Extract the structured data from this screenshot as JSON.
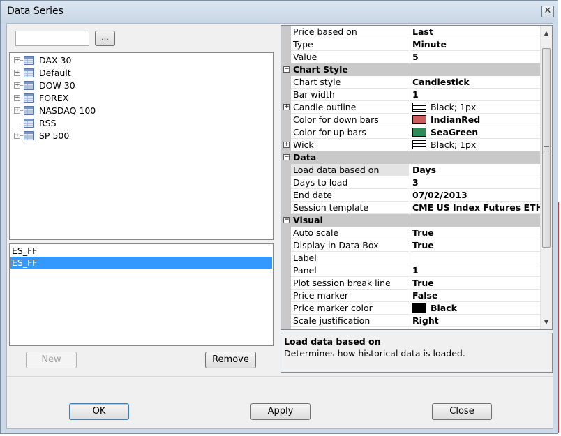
{
  "window": {
    "title": "Data Series",
    "close_glyph": "✕"
  },
  "search": {
    "value": "",
    "browse_label": "..."
  },
  "tree": {
    "items": [
      {
        "label": "DAX 30",
        "expandable": true
      },
      {
        "label": "Default",
        "expandable": true
      },
      {
        "label": "DOW 30",
        "expandable": true
      },
      {
        "label": "FOREX",
        "expandable": true
      },
      {
        "label": "NASDAQ 100",
        "expandable": true
      },
      {
        "label": "RSS",
        "expandable": false
      },
      {
        "label": "SP 500",
        "expandable": true
      }
    ]
  },
  "series_list": {
    "items": [
      {
        "label": "ES_FF",
        "selected": false
      },
      {
        "label": "ES_FF",
        "selected": true
      }
    ],
    "new_label": "New",
    "remove_label": "Remove"
  },
  "properties": {
    "top_rows": [
      {
        "name": "Price based on",
        "value": "Last"
      },
      {
        "name": "Type",
        "value": "Minute"
      },
      {
        "name": "Value",
        "value": "5"
      }
    ],
    "chart_style": {
      "category": "Chart Style",
      "rows": [
        {
          "name": "Chart style",
          "value": "Candlestick"
        },
        {
          "name": "Bar width",
          "value": "1"
        },
        {
          "name": "Candle outline",
          "value": "Black; 1px",
          "expandable": true
        },
        {
          "name": "Color for down bars",
          "value": "IndianRed",
          "swatch": "#cd5c5c"
        },
        {
          "name": "Color for up bars",
          "value": "SeaGreen",
          "swatch": "#2e8b57"
        },
        {
          "name": "Wick",
          "value": "Black; 1px",
          "expandable": true
        }
      ]
    },
    "data": {
      "category": "Data",
      "rows": [
        {
          "name": "Load data based on",
          "value": "Days",
          "highlighted": true
        },
        {
          "name": "Days to load",
          "value": "3"
        },
        {
          "name": "End date",
          "value": "07/02/2013"
        },
        {
          "name": "Session template",
          "value": "CME US Index Futures ETH"
        }
      ]
    },
    "visual": {
      "category": "Visual",
      "rows": [
        {
          "name": "Auto scale",
          "value": "True"
        },
        {
          "name": "Display in Data Box",
          "value": "True"
        },
        {
          "name": "Label",
          "value": ""
        },
        {
          "name": "Panel",
          "value": "1"
        },
        {
          "name": "Plot session break line",
          "value": "True"
        },
        {
          "name": "Price marker",
          "value": "False"
        },
        {
          "name": "Price marker color",
          "value": "Black",
          "swatch": "#000000"
        },
        {
          "name": "Scale justification",
          "value": "Right"
        }
      ]
    }
  },
  "help": {
    "title": "Load data based on",
    "description": "Determines how historical data is loaded."
  },
  "footer": {
    "ok_label": "OK",
    "apply_label": "Apply",
    "close_label": "Close"
  },
  "colors": {
    "selection": "#3399ff",
    "category_bg": "#c9c9c9",
    "window_frame": "#cdd9e6"
  }
}
